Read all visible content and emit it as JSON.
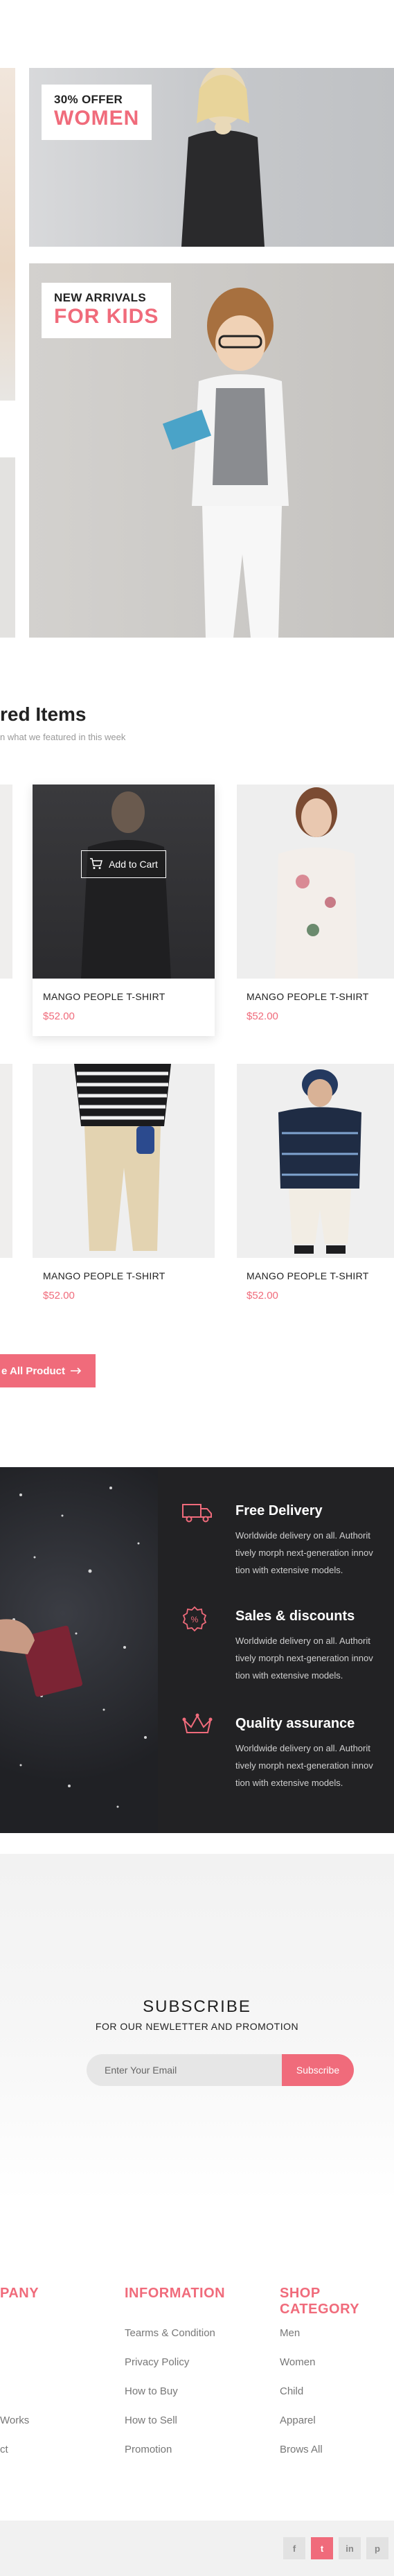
{
  "banners": [
    {
      "small": "30% OFFER",
      "big": "WOMEN"
    },
    {
      "small": "NEW ARRIVALS",
      "big": "FOR KIDS"
    }
  ],
  "featured": {
    "title": "red Items",
    "subtitle": "n what we featured in this week",
    "add_to_cart": "Add to Cart",
    "products": [
      {
        "name": "MANGO PEOPLE T-SHIRT",
        "price": "$52.00"
      },
      {
        "name": "MANGO PEOPLE T-SHIRT",
        "price": "$52.00"
      },
      {
        "name": "MANGO PEOPLE T-SHIRT",
        "price": "$52.00"
      },
      {
        "name": "MANGO PEOPLE T-SHIRT",
        "price": "$52.00"
      }
    ],
    "view_all": "e All Product"
  },
  "features": [
    {
      "icon": "truck-icon",
      "title": "Free Delivery",
      "lines": [
        "Worldwide delivery on all. Authorit",
        "tively morph next-generation innov",
        "tion with extensive models."
      ]
    },
    {
      "icon": "percent-badge-icon",
      "title": "Sales & discounts",
      "lines": [
        "Worldwide delivery on all. Authorit",
        "tively morph next-generation innov",
        "tion with extensive models."
      ]
    },
    {
      "icon": "crown-icon",
      "title": "Quality assurance",
      "lines": [
        "Worldwide delivery on all. Authorit",
        "tively morph next-generation innov",
        "tion with extensive models."
      ]
    }
  ],
  "subscribe": {
    "title": "SUBSCRIBE",
    "subtitle": "FOR OUR NEWLETTER AND PROMOTION",
    "placeholder": "Enter Your Email",
    "button": "Subscribe"
  },
  "footer": {
    "company": {
      "heading": "PANY",
      "links": [
        "Works",
        "ct"
      ]
    },
    "information": {
      "heading": "INFORMATION",
      "links": [
        "Tearms & Condition",
        "Privacy Policy",
        "How to Buy",
        "How to Sell",
        "Promotion"
      ]
    },
    "shop": {
      "heading": "SHOP CATEGORY",
      "links": [
        "Men",
        "Women",
        "Child",
        "Apparel",
        "Brows All"
      ]
    },
    "social": [
      "f",
      "t",
      "in",
      "p"
    ]
  },
  "colors": {
    "accent": "#f06b7b",
    "dark": "#222222"
  }
}
